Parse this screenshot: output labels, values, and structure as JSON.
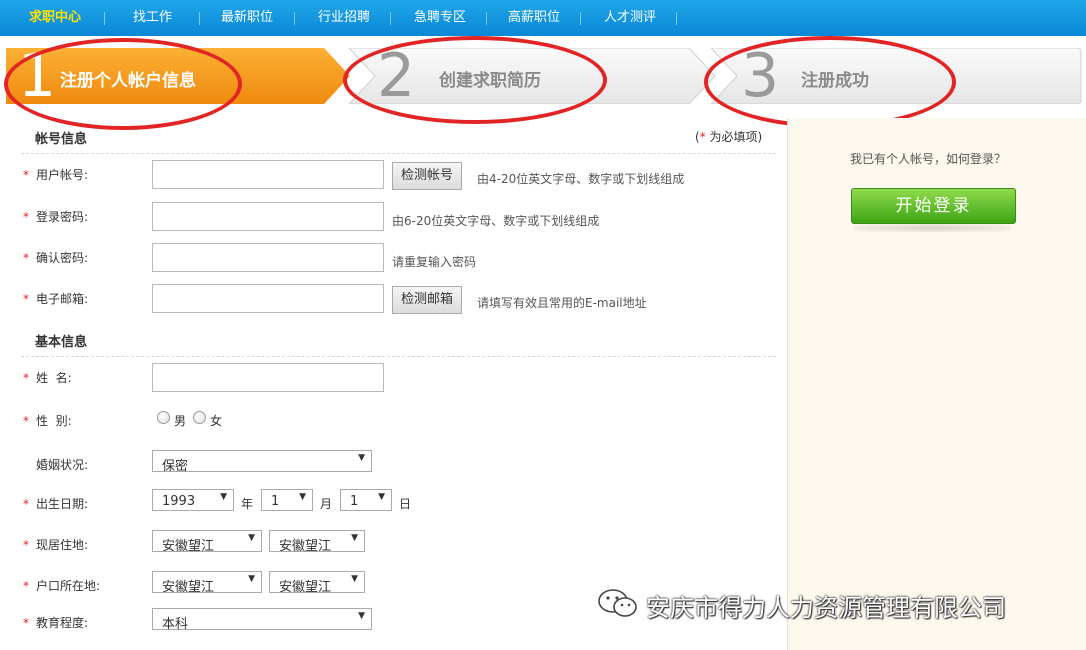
{
  "nav": {
    "items": [
      "求职中心",
      "找工作",
      "最新职位",
      "行业招聘",
      "急聘专区",
      "高薪职位",
      "人才测评"
    ]
  },
  "steps": [
    {
      "number": "1",
      "label": "注册个人帐户信息"
    },
    {
      "number": "2",
      "label": "创建求职简历"
    },
    {
      "number": "3",
      "label": "注册成功"
    }
  ],
  "form": {
    "account_section": "帐号信息",
    "required_note_star": "*",
    "required_note_text": "为必填项)",
    "required_note_open": "(",
    "basic_section": "基本信息",
    "username": {
      "label": "用户帐号:",
      "button": "检测帐号",
      "hint": "由4-20位英文字母、数字或下划线组成"
    },
    "password": {
      "label": "登录密码:",
      "hint": "由6-20位英文字母、数字或下划线组成"
    },
    "confirm": {
      "label": "确认密码:",
      "hint": "请重复输入密码"
    },
    "email": {
      "label": "电子邮箱:",
      "button": "检测邮箱",
      "hint": "请填写有效且常用的E-mail地址"
    },
    "name": {
      "label": "姓  名:"
    },
    "gender": {
      "label": "性  别:",
      "male": "男",
      "female": "女"
    },
    "marital": {
      "label": "婚姻状况:",
      "value": "保密"
    },
    "birth": {
      "label": "出生日期:",
      "year": "1993",
      "year_unit": "年",
      "month": "1",
      "month_unit": "月",
      "day": "1",
      "day_unit": "日"
    },
    "residence": {
      "label": "现居住地:",
      "province": "安徽望江",
      "city": "安徽望江"
    },
    "hukou": {
      "label": "户口所在地:",
      "province": "安徽望江",
      "city": "安徽望江"
    },
    "education": {
      "label": "教育程度:",
      "value": "本科"
    },
    "star": "*"
  },
  "side": {
    "have_account": "我已有个人帐号，如何登录？",
    "login_button": "开始登录"
  },
  "watermark": {
    "text": "安庆市得力人力资源管理有限公司",
    "icon": "wechat-icon"
  },
  "colors": {
    "nav_bg": "#0a88d6",
    "active_nav": "#ffe000",
    "step_active": "#f7941d",
    "highlight_circle": "#e22424",
    "login_green": "#3da414"
  }
}
